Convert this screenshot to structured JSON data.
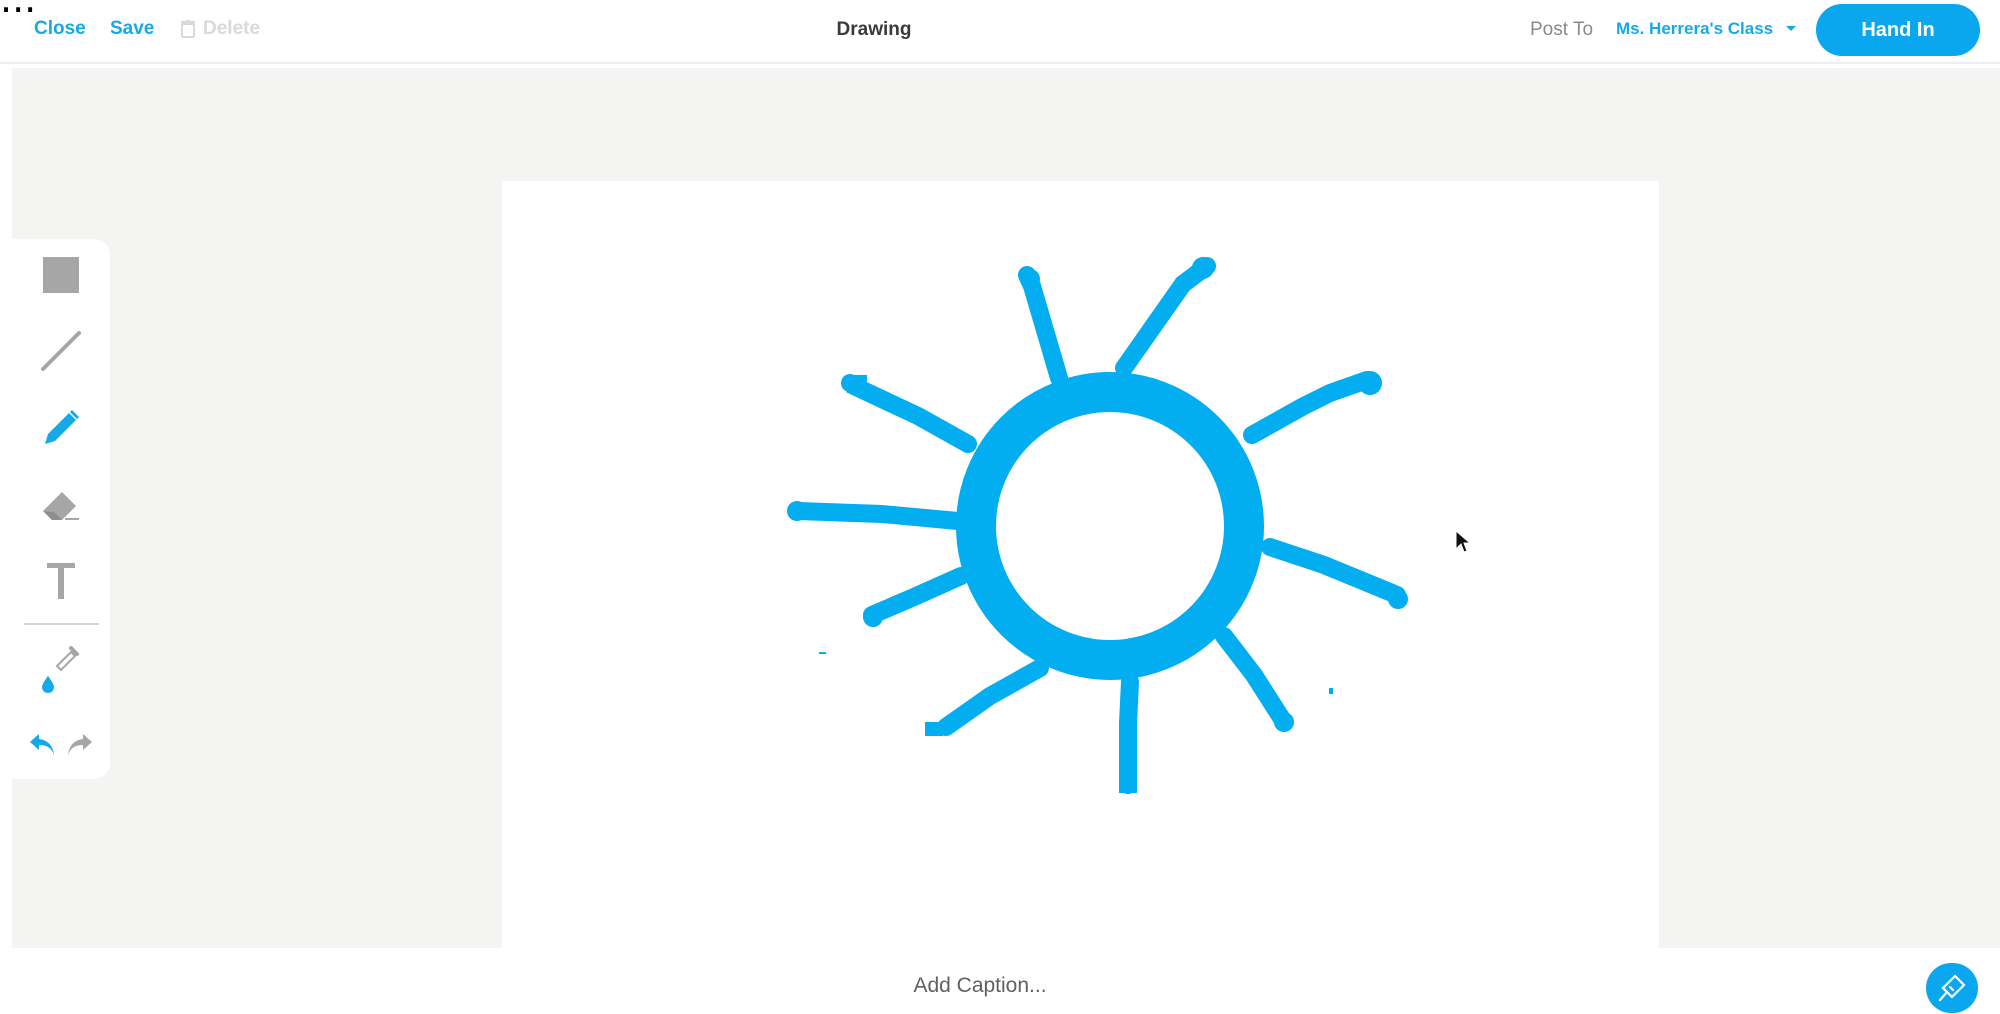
{
  "header": {
    "close_label": "Close",
    "save_label": "Save",
    "delete_label": "Delete",
    "title": "Drawing",
    "post_to_label": "Post To",
    "class_name": "Ms. Herrera's Class",
    "hand_in_label": "Hand In"
  },
  "top_overlay_text": "...",
  "toolbar": {
    "tools": [
      {
        "name": "shape",
        "icon": "square-icon"
      },
      {
        "name": "line",
        "icon": "line-icon"
      },
      {
        "name": "pen",
        "icon": "pencil-icon",
        "selected": true
      },
      {
        "name": "eraser",
        "icon": "eraser-icon"
      },
      {
        "name": "text",
        "icon": "text-icon"
      },
      {
        "name": "color",
        "icon": "eyedropper-icon"
      },
      {
        "name": "undo",
        "icon": "undo-icon"
      },
      {
        "name": "redo",
        "icon": "redo-icon"
      }
    ]
  },
  "footer": {
    "caption_placeholder": "Add Caption..."
  },
  "colors": {
    "accent": "#0aa7ee",
    "drawing_stroke": "#02adf0",
    "workspace_bg": "#f4f4f3",
    "tool_gray": "#a6a6a6"
  }
}
